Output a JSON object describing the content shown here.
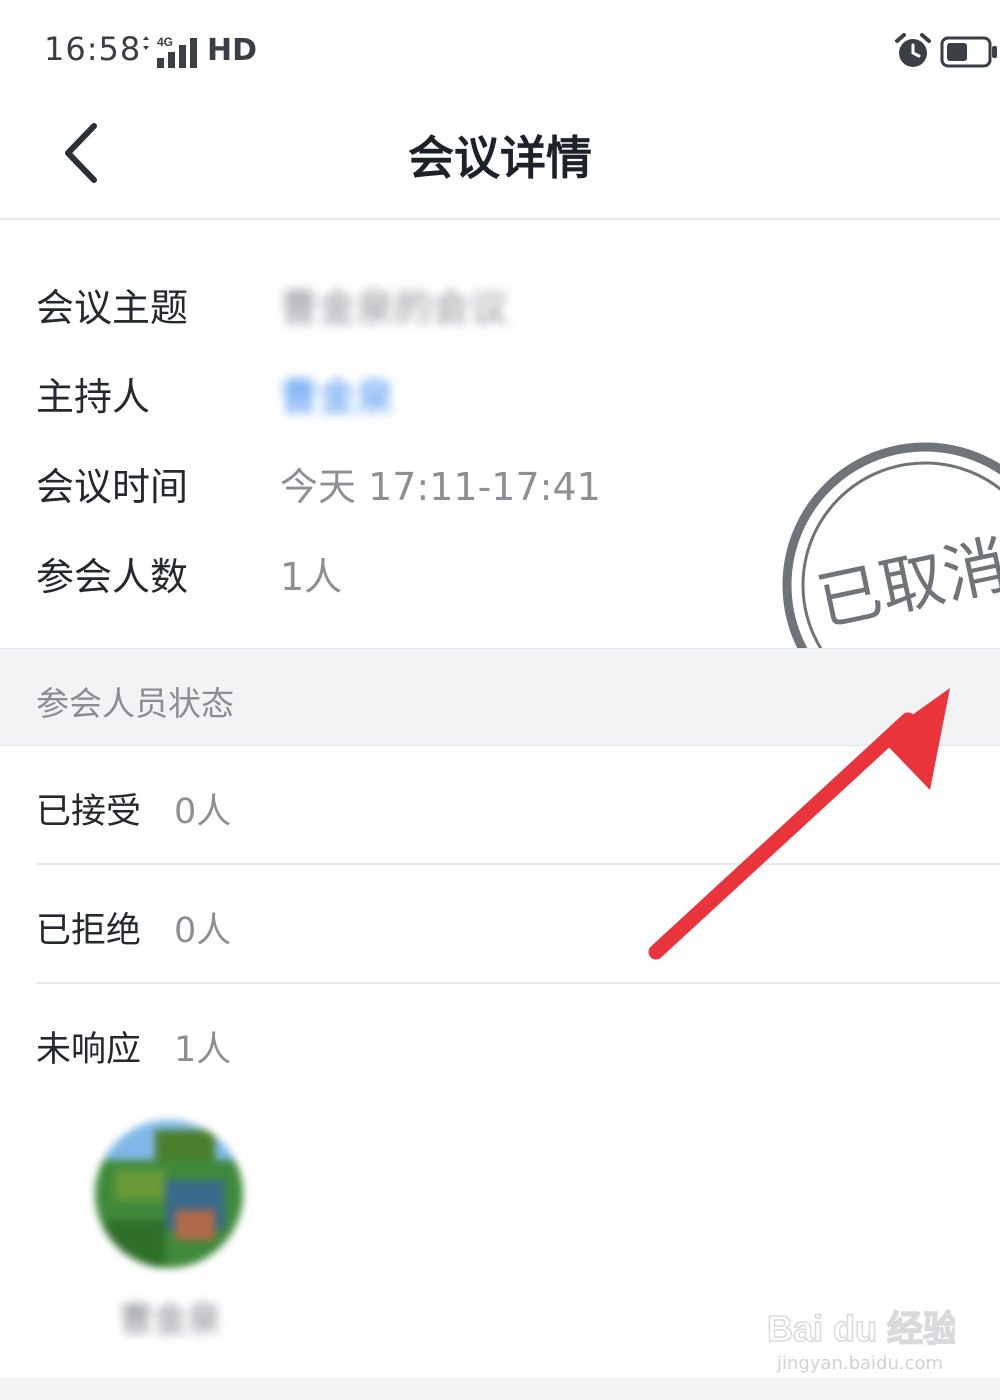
{
  "status_bar": {
    "time": "16:58",
    "network": "4G",
    "hd": "HD",
    "icons": [
      "alarm-icon",
      "battery-icon"
    ]
  },
  "nav": {
    "title": "会议详情",
    "back_icon": "chevron-left-icon"
  },
  "info": {
    "topic_label": "会议主题",
    "topic_value": "曹金泉的会议",
    "host_label": "主持人",
    "host_value": "曹金泉",
    "time_label": "会议时间",
    "time_value": "今天 17:11-17:41",
    "count_label": "参会人数",
    "count_value": "1人"
  },
  "stamp": {
    "text": "已取消",
    "color": "#6f7479"
  },
  "attendee_status": {
    "section_title": "参会人员状态",
    "rows": [
      {
        "label": "已接受",
        "count": "0人"
      },
      {
        "label": "已拒绝",
        "count": "0人"
      },
      {
        "label": "未响应",
        "count": "1人"
      }
    ]
  },
  "participants": [
    {
      "name": "曹金泉",
      "avatar": "avatar-icon"
    }
  ],
  "annotation": {
    "arrow_color": "#e8343a"
  },
  "watermark": {
    "brand": "Bai du 经验",
    "url": "jingyan.baidu.com"
  },
  "colors": {
    "host_link": "#3d8cf0",
    "section_bg": "#f2f3f5"
  }
}
